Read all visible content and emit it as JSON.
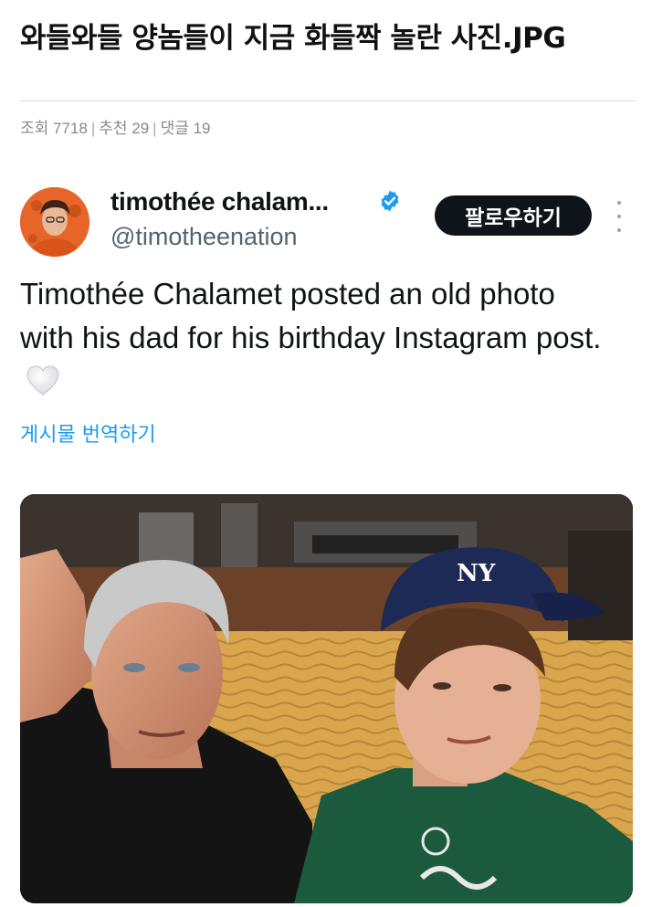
{
  "post": {
    "title": "와들와들 양놈들이 지금 화들짝 놀란 사진.JPG",
    "meta": {
      "views_label": "조회 7718",
      "likes_label": "추천 29",
      "comments_label": "댓글 19",
      "separator": "|"
    }
  },
  "tweet": {
    "display_name": "timothée chalam...",
    "handle": "@timotheenation",
    "follow_label": "팔로우하기",
    "verified": true,
    "body": "Timothée Chalamet posted an old photo with his dad for his birthday Instagram post.",
    "emoji": "white-heart-icon",
    "translate_label": "게시물 번역하기",
    "photo": {
      "cap_logo": "NY"
    }
  },
  "colors": {
    "link": "#1d9bf0",
    "follow_bg": "#0f1419",
    "verified": "#1d9bf0",
    "meta": "#888888"
  }
}
